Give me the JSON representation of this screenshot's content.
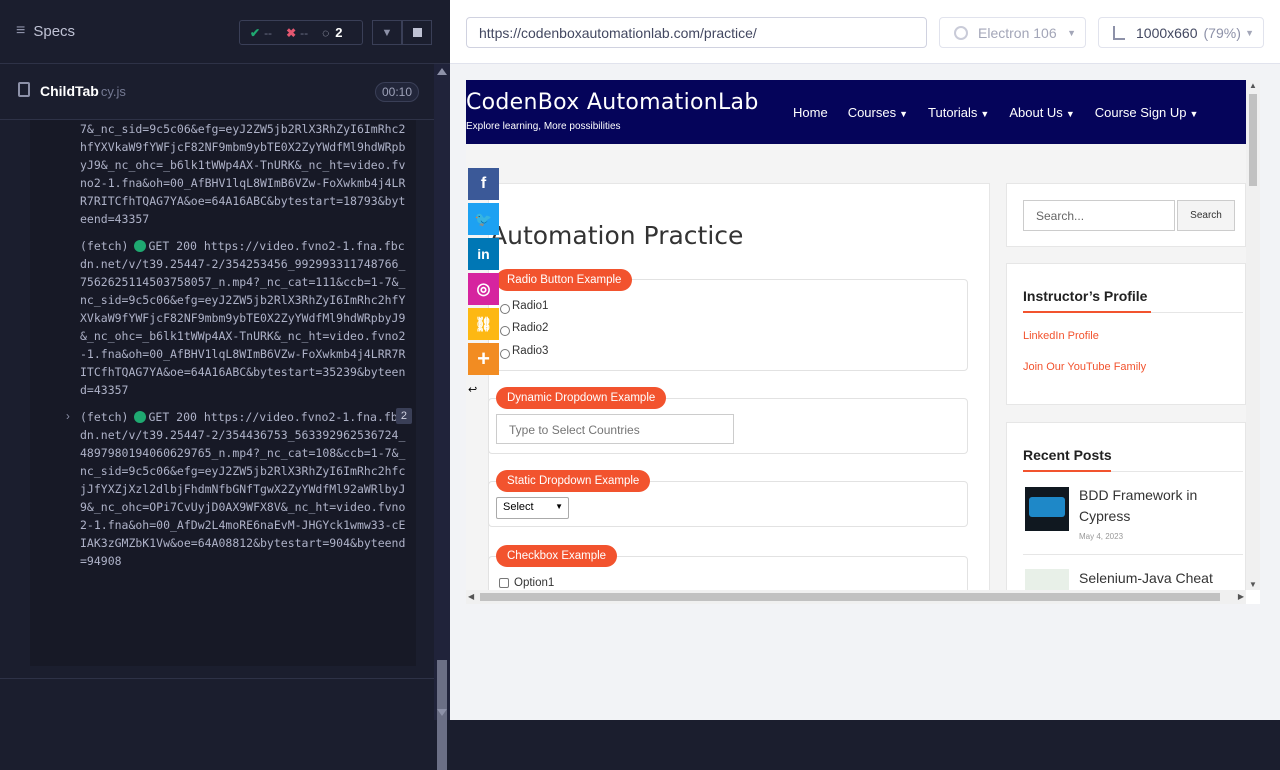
{
  "runner": {
    "specs_label": "Specs",
    "stats": {
      "passed": "--",
      "failed": "--",
      "pending": "2"
    },
    "spec_file": {
      "name": "ChildTab",
      "ext": "cy.js",
      "time": "00:10"
    },
    "log": [
      {
        "text": "7&_nc_sid=9c5c06&efg=eyJ2ZW5jb2RlX3RhZyI6ImRhc2hfYXVkaW9fYWFjcF82NF9mbm9ybTE0X2ZyYWdfMl9hdWRpbyJ9&_nc_ohc=_b6lk1tWWp4AX-TnURK&_nc_ht=video.fvno2-1.fna&oh=00_AfBHV1lqL8WImB6VZw-FoXwkmb4j4LRR7RITCfhTQAG7YA&oe=64A16ABC&bytestart=18793&byteend=43357"
      },
      {
        "tag": "(fetch)",
        "method": "GET 200 https://video.fvno2-1.fna.fbcdn.net/v/t39.25447-2/354253456_992993311748766_7562625114503758057_n.mp4?_nc_cat=111&ccb=1-7&_nc_sid=9c5c06&efg=eyJ2ZW5jb2RlX3RhZyI6ImRhc2hfYXVkaW9fYWFjcF82NF9mbm9ybTE0X2ZyYWdfMl9hdWRpbyJ9&_nc_ohc=_b6lk1tWWp4AX-TnURK&_nc_ht=video.fvno2-1.fna&oh=00_AfBHV1lqL8WImB6VZw-FoXwkmb4j4LRR7RITCfhTQAG7YA&oe=64A16ABC&bytestart=35239&byteend=43357"
      },
      {
        "tag": "(fetch)",
        "count": "2",
        "method": "GET 200 https://video.fvno2-1.fna.fbcdn.net/v/t39.25447-2/354436753_563392962536724_4897980194060629765_n.mp4?_nc_cat=108&ccb=1-7&_nc_sid=9c5c06&efg=eyJ2ZW5jb2RlX3RhZyI6ImRhc2hfcjJfYXZjXzl2dlbjFhdmNfbGNfTgwX2ZyYWdfMl92aWRlbyJ9&_nc_ohc=OPi7CvUyjD0AX9WFX8V&_nc_ht=video.fvno2-1.fna&oh=00_AfDw2L4moRE6naEvM-JHGYck1wmw33-cEIAK3zGMZbK1Vw&oe=64A08812&bytestart=904&byteend=94908"
      }
    ]
  },
  "browser_bar": {
    "url": "https://codenboxautomationlab.com/practice/",
    "browser": "Electron 106",
    "viewport": "1000x660",
    "zoom": "(79%)"
  },
  "site": {
    "title": "CodenBox AutomationLab",
    "tagline": "Explore learning, More possibilities",
    "nav": [
      "Home",
      "Courses",
      "Tutorials",
      "About Us",
      "Course Sign Up"
    ],
    "page_title": "Automation Practice",
    "radio_section": {
      "label": "Radio Button Example",
      "options": [
        "Radio1",
        "Radio2",
        "Radio3"
      ]
    },
    "dynamic_dropdown": {
      "label": "Dynamic Dropdown Example",
      "placeholder": "Type to Select Countries"
    },
    "static_dropdown": {
      "label": "Static Dropdown Example",
      "selected": "Select"
    },
    "checkbox_section": {
      "label": "Checkbox Example",
      "option1": "Option1"
    },
    "search": {
      "placeholder": "Search...",
      "button": "Search"
    },
    "instructor": {
      "title": "Instructor’s Profile",
      "links": [
        "LinkedIn Profile",
        "Join Our YouTube Family"
      ]
    },
    "recent_posts": {
      "title": "Recent Posts",
      "posts": [
        {
          "title": "BDD Framework in Cypress",
          "date": "May 4, 2023"
        },
        {
          "title": "Selenium-Java Cheat"
        }
      ]
    },
    "social": [
      {
        "name": "facebook",
        "glyph": "f",
        "color": "#3b5998"
      },
      {
        "name": "twitter",
        "glyph": "🐦",
        "color": "#1da1f2"
      },
      {
        "name": "linkedin",
        "glyph": "in",
        "color": "#0077b5"
      },
      {
        "name": "instagram",
        "glyph": "◎",
        "color": "#d6249f"
      },
      {
        "name": "copy-link",
        "glyph": "⛓",
        "color": "#fdb813"
      },
      {
        "name": "more",
        "glyph": "+",
        "color": "#f28c22"
      }
    ]
  }
}
